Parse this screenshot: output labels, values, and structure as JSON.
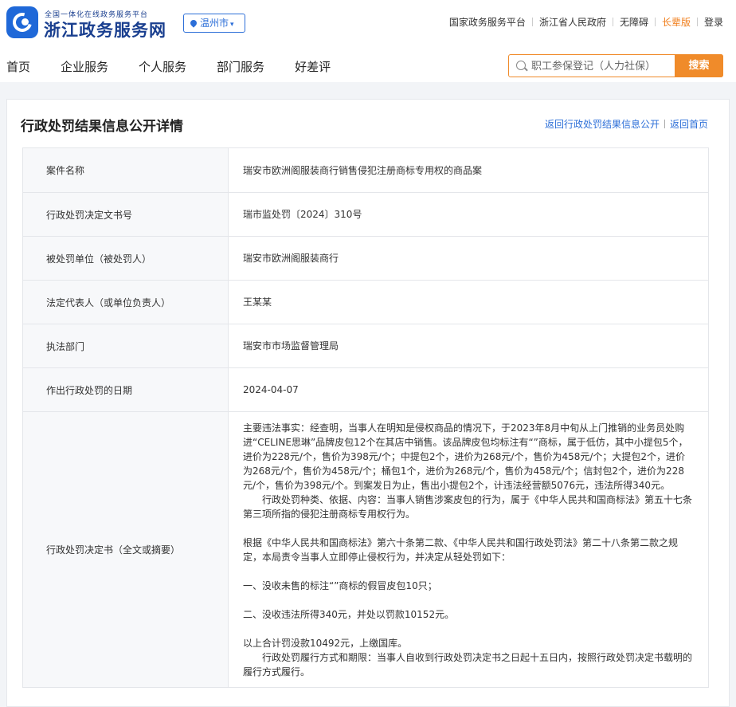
{
  "header": {
    "slogan": "全国一体化在线政务服务平台",
    "site_title": "浙江政务服务网",
    "city": "温州市",
    "top_links": [
      "国家政务服务平台",
      "浙江省人民政府",
      "无障碍",
      "长辈版",
      "登录"
    ]
  },
  "nav": [
    "首页",
    "企业服务",
    "个人服务",
    "部门服务",
    "好差评"
  ],
  "search": {
    "placeholder": "职工参保登记（人力社保）",
    "button": "搜索"
  },
  "page": {
    "title": "行政处罚结果信息公开详情",
    "back_link": "返回行政处罚结果信息公开",
    "home_link": "返回首页"
  },
  "rows": [
    {
      "label": "案件名称",
      "value": "瑞安市欧洲阁服装商行销售侵犯注册商标专用权的商品案"
    },
    {
      "label": "行政处罚决定文书号",
      "value": "瑞市监处罚〔2024〕310号"
    },
    {
      "label": "被处罚单位（被处罚人）",
      "value": "瑞安市欧洲阁服装商行"
    },
    {
      "label": "法定代表人（或单位负责人）",
      "value": "王某某"
    },
    {
      "label": "执法部门",
      "value": "瑞安市市场监督管理局"
    },
    {
      "label": "作出行政处罚的日期",
      "value": "2024-04-07"
    }
  ],
  "full_text": {
    "label": "行政处罚决定书（全文或摘要）",
    "p1": "主要违法事实：经查明，当事人在明知是侵权商品的情况下，于2023年8月中旬从上门推销的业务员处购进“CELINE思琳”品牌皮包12个在其店中销售。该品牌皮包均标注有“”商标，属于低仿，其中小提包5个，进价为228元/个，售价为398元/个；中提包2个，进价为268元/个，售价为458元/个；大提包2个，进价为268元/个，售价为458元/个；桶包1个，进价为268元/个，售价为458元/个；信封包2个，进价为228元/个，售价为398元/个。到案发日为止，售出小提包2个，计违法经营额5076元，违法所得340元。",
    "p2": "行政处罚种类、依据、内容：当事人销售涉案皮包的行为，属于《中华人民共和国商标法》第五十七条第三项所指的侵犯注册商标专用权行为。",
    "p3": "根据《中华人民共和国商标法》第六十条第二款、《中华人民共和国行政处罚法》第二十八条第二款之规定，本局责令当事人立即停止侵权行为，并决定从轻处罚如下：",
    "p4": "一、没收未售的标注“”商标的假冒皮包10只；",
    "p5": "二、没收违法所得340元，并处以罚款10152元。",
    "p6": "以上合计罚没款10492元，上缴国库。",
    "p7": "行政处罚履行方式和期限：当事人自收到行政处罚决定书之日起十五日内，按照行政处罚决定书载明的履行方式履行。"
  },
  "colors": {
    "brand_blue": "#1a3f8f",
    "link_blue": "#2d6fd8",
    "accent_orange": "#f08b2a"
  }
}
